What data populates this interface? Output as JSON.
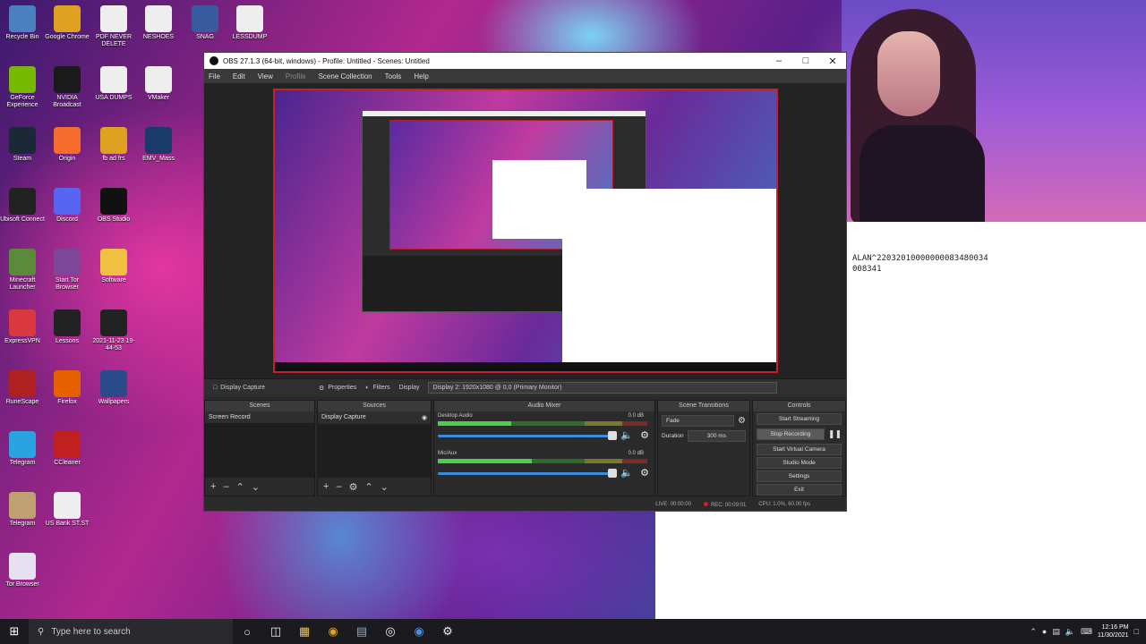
{
  "desktop": {
    "icons": [
      {
        "label": "Recycle Bin",
        "icon": "recycle-bin-icon",
        "color": "#4a7fc0"
      },
      {
        "label": "Google Chrome",
        "icon": "chrome-icon",
        "color": "#e0a020"
      },
      {
        "label": "PDF NEVER DELETE",
        "icon": "file-icon",
        "color": "#eeeeee"
      },
      {
        "label": "NESHOES",
        "icon": "file-icon",
        "color": "#eeeeee"
      },
      {
        "label": "SNAG",
        "icon": "app-icon",
        "color": "#3a5aa0"
      },
      {
        "label": "LESSDUMP",
        "icon": "file-icon",
        "color": "#eeeeee"
      },
      {
        "label": "GeForce Experience",
        "icon": "geforce-icon",
        "color": "#76b900"
      },
      {
        "label": "NVIDIA Broadcast",
        "icon": "nvidia-icon",
        "color": "#1a1a1a"
      },
      {
        "label": "USA DUMPS",
        "icon": "file-icon",
        "color": "#eeeeee"
      },
      {
        "label": "VMaker",
        "icon": "file-icon",
        "color": "#eeeeee"
      },
      {
        "label": "Steam",
        "icon": "steam-icon",
        "color": "#1b2838"
      },
      {
        "label": "Origin",
        "icon": "origin-icon",
        "color": "#f56c2d"
      },
      {
        "label": "fb ad frs",
        "icon": "chrome-icon",
        "color": "#e0a020"
      },
      {
        "label": "EMV_Mass",
        "icon": "app-icon",
        "color": "#1a3a6a"
      },
      {
        "label": "Ubisoft Connect",
        "icon": "ubisoft-icon",
        "color": "#222222"
      },
      {
        "label": "Discord",
        "icon": "discord-icon",
        "color": "#5865f2"
      },
      {
        "label": "OBS Studio",
        "icon": "obs-icon",
        "color": "#111111"
      },
      {
        "label": "Minecraft Launcher",
        "icon": "minecraft-icon",
        "color": "#5a8a3a"
      },
      {
        "label": "Start Tor Browser",
        "icon": "tor-icon",
        "color": "#7d4698"
      },
      {
        "label": "Software",
        "icon": "folder-icon",
        "color": "#f0c040"
      },
      {
        "label": "ExpressVPN",
        "icon": "vpn-icon",
        "color": "#da3940"
      },
      {
        "label": "Lessons",
        "icon": "app-icon",
        "color": "#222222"
      },
      {
        "label": "2021-11-23 19-44-53",
        "icon": "video-icon",
        "color": "#222222"
      },
      {
        "label": "RuneScape",
        "icon": "app-icon",
        "color": "#b02020"
      },
      {
        "label": "Firefox",
        "icon": "firefox-icon",
        "color": "#e66000"
      },
      {
        "label": "Wallpapers",
        "icon": "app-icon",
        "color": "#2a4a8a"
      },
      {
        "label": "Telegram",
        "icon": "telegram-icon",
        "color": "#2aa3e0"
      },
      {
        "label": "CCleaner",
        "icon": "ccleaner-icon",
        "color": "#c02020"
      },
      {
        "label": "Telegram",
        "icon": "telegram-file-icon",
        "color": "#bfa070"
      },
      {
        "label": "US Bank ST.ST",
        "icon": "file-icon",
        "color": "#eeeeee"
      },
      {
        "label": "Tor Browser",
        "icon": "tor-file-icon",
        "color": "#e6e0f0"
      }
    ],
    "background_text": [
      "ALAN^22032010000000083480034",
      "008341"
    ]
  },
  "obs": {
    "title": "OBS 27.1.3 (64-bit, windows) - Profile: Untitled - Scenes: Untitled",
    "menu": [
      "File",
      "Edit",
      "View",
      "Profile",
      "Scene Collection",
      "Tools",
      "Help"
    ],
    "source_bar": {
      "source_name": "Display Capture",
      "properties": "Properties",
      "filters": "Filters",
      "display_label": "Display",
      "display_value": "Display 2: 1920x1080 @ 0,0 (Primary Monitor)"
    },
    "docks": {
      "scenes": {
        "title": "Scenes",
        "items": [
          "Screen Record"
        ]
      },
      "sources": {
        "title": "Sources",
        "items": [
          "Display Capture"
        ]
      },
      "mixer": {
        "title": "Audio Mixer",
        "channels": [
          {
            "name": "Desktop Audio",
            "db": "0.0 dB",
            "level": 0.35
          },
          {
            "name": "Mic/Aux",
            "db": "0.0 dB",
            "level": 0.45
          }
        ]
      },
      "transitions": {
        "title": "Scene Transitions",
        "type": "Fade",
        "duration_label": "Duration",
        "duration_value": "300 ms"
      },
      "controls": {
        "title": "Controls",
        "buttons": [
          "Start Streaming",
          "Stop Recording",
          "Start Virtual Camera",
          "Studio Mode",
          "Settings",
          "Exit"
        ]
      }
    },
    "status": {
      "live": "LIVE: 00:00:00",
      "rec": "REC: 00:09:01",
      "cpu": "CPU: 1.0%, 60.00 fps"
    }
  },
  "taskbar": {
    "search_placeholder": "Type here to search",
    "time": "12:16 PM",
    "date": "11/30/2021"
  }
}
